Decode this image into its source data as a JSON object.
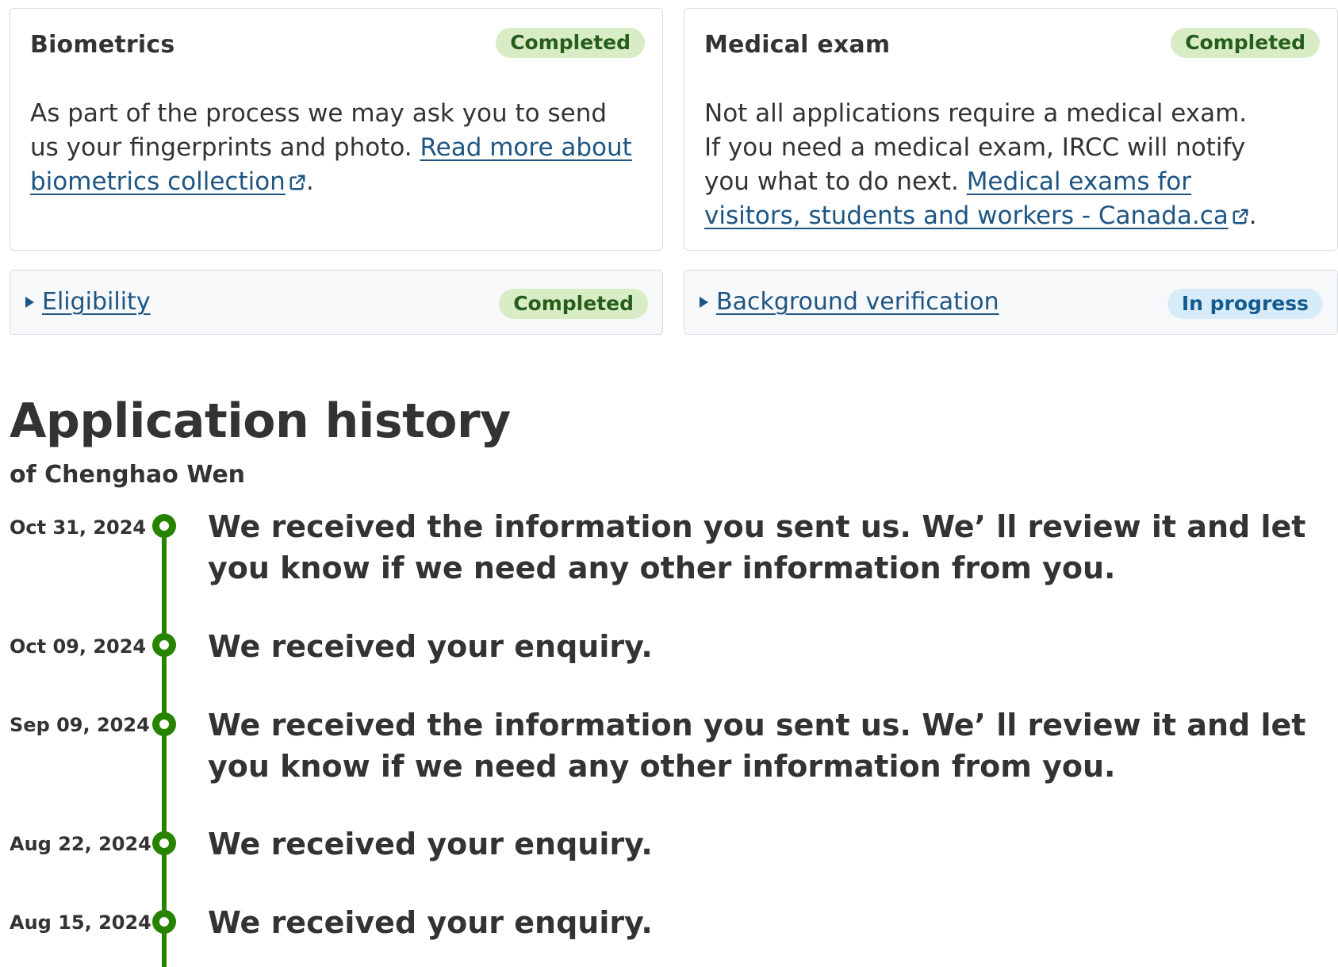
{
  "cards": {
    "biometrics": {
      "title": "Biometrics",
      "status": "Completed",
      "body_text": "As part of the process we may ask you to send us your fingerprints and photo. ",
      "link_text": "Read more about biometrics collection",
      "trailing": "."
    },
    "medical": {
      "title": "Medical exam",
      "status": "Completed",
      "body_text": "Not all applications require a medical exam. If you need a medical exam, IRCC will notify you what to do next. ",
      "link_text": "Medical exams for visitors, students and workers - Canada.ca",
      "trailing": "."
    }
  },
  "accordions": {
    "eligibility": {
      "label": "Eligibility",
      "status": "Completed"
    },
    "background": {
      "label": "Background verification",
      "status": "In progress"
    }
  },
  "history": {
    "title": "Application history",
    "subtitle": "of Chenghao Wen",
    "events": [
      {
        "date": "Oct 31, 2024",
        "text": "We received the information you sent us. We’ ll review it and let you know if we need any other information from you."
      },
      {
        "date": "Oct 09, 2024",
        "text": "We received your enquiry."
      },
      {
        "date": "Sep 09, 2024",
        "text": "We received the information you sent us. We’ ll review it and let you know if we need any other information from you."
      },
      {
        "date": "Aug 22, 2024",
        "text": "We received your enquiry."
      },
      {
        "date": "Aug 15, 2024",
        "text": "We received your enquiry."
      }
    ]
  },
  "colors": {
    "link": "#1e5583",
    "completed_badge_bg": "#d8ecc6",
    "completed_badge_text": "#265d1a",
    "in_progress_badge_bg": "#d7ebf8",
    "in_progress_badge_text": "#135b8f",
    "timeline": "#278400"
  },
  "icons": {
    "external_link": "external-link-icon",
    "accordion_toggle": "caret-right-icon",
    "timeline_marker": "timeline-dot-icon"
  }
}
